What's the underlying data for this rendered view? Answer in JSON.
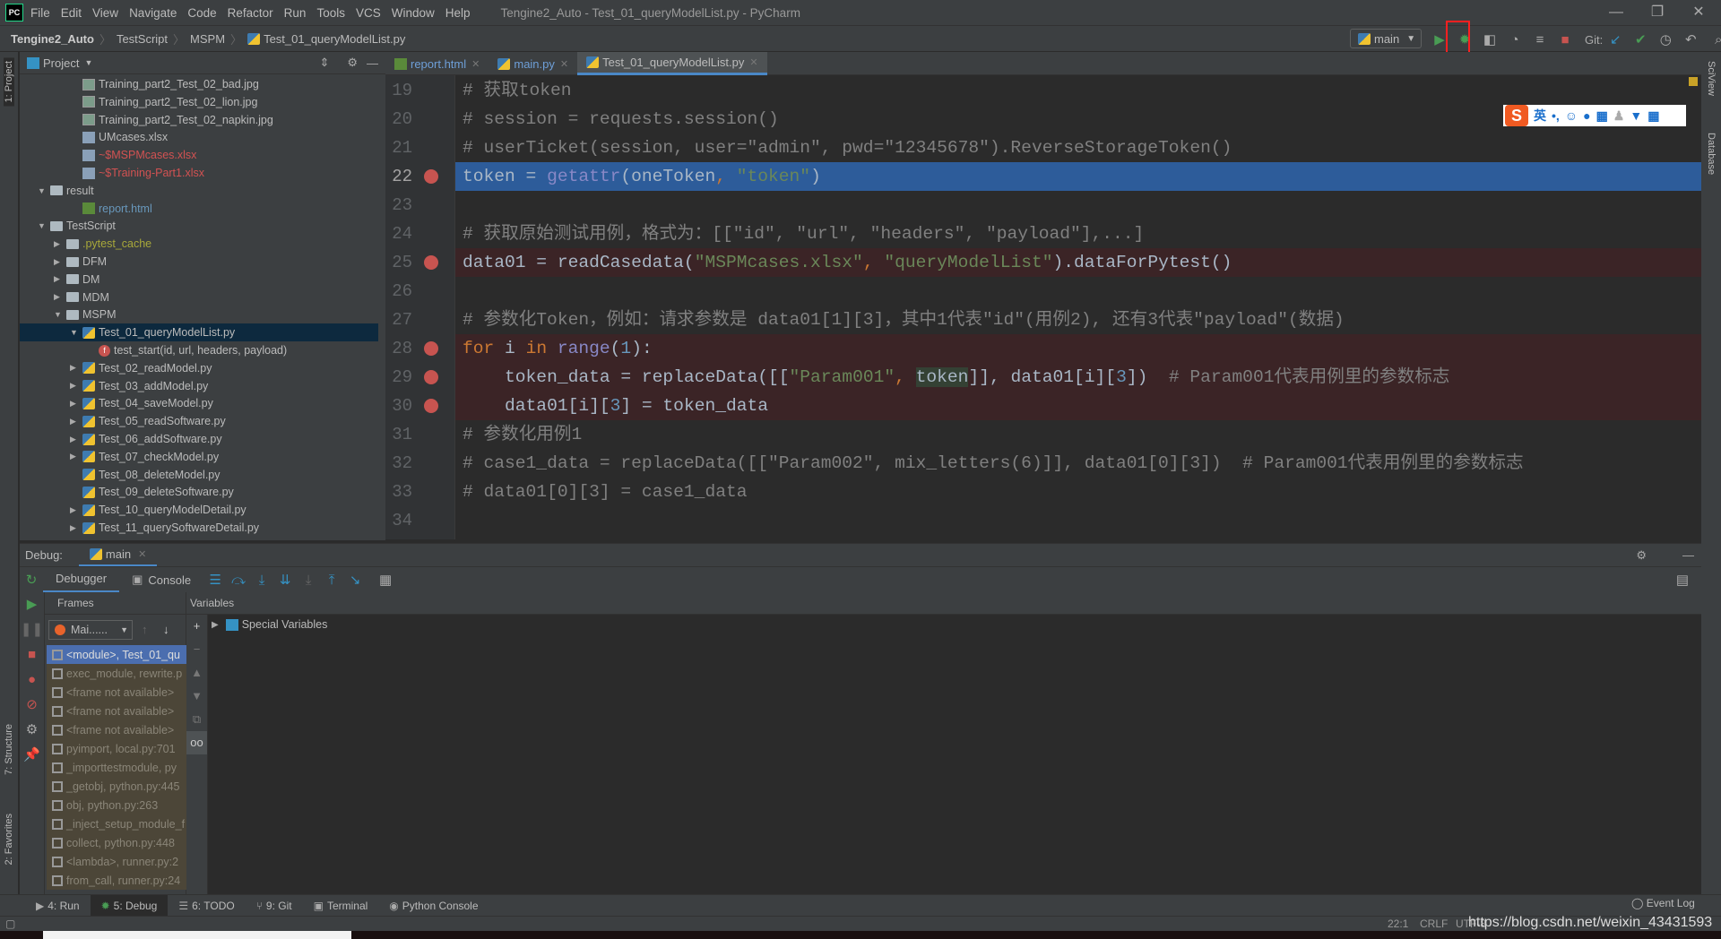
{
  "menubar": {
    "logo": "PC",
    "items": [
      "File",
      "Edit",
      "View",
      "Navigate",
      "Code",
      "Refactor",
      "Run",
      "Tools",
      "VCS",
      "Window",
      "Help"
    ],
    "title": "Tengine2_Auto - Test_01_queryModelList.py - PyCharm"
  },
  "navbar": {
    "crumbs": [
      "Tengine2_Auto",
      "TestScript",
      "MSPM",
      "Test_01_queryModelList.py"
    ],
    "run_config": "main",
    "git_label": "Git:"
  },
  "project": {
    "title": "Project",
    "sidebar_tab": "1: Project",
    "tree": [
      {
        "label": "Training_part2_Test_02_bad.jpg",
        "level": 3,
        "icon": "image-file",
        "arrow": ""
      },
      {
        "label": "Training_part2_Test_02_lion.jpg",
        "level": 3,
        "icon": "image-file",
        "arrow": ""
      },
      {
        "label": "Training_part2_Test_02_napkin.jpg",
        "level": 3,
        "icon": "image-file",
        "arrow": ""
      },
      {
        "label": "UMcases.xlsx",
        "level": 3,
        "icon": "xlsx-file",
        "arrow": ""
      },
      {
        "label": "~$MSPMcases.xlsx",
        "level": 3,
        "icon": "xlsx-file",
        "arrow": "",
        "color": "#d25252"
      },
      {
        "label": "~$Training-Part1.xlsx",
        "level": 3,
        "icon": "xlsx-file",
        "arrow": "",
        "color": "#d25252"
      },
      {
        "label": "result",
        "level": 1,
        "icon": "folder",
        "arrow": "down"
      },
      {
        "label": "report.html",
        "level": 3,
        "icon": "html-file",
        "arrow": "",
        "color": "#6897bb"
      },
      {
        "label": "TestScript",
        "level": 1,
        "icon": "folder",
        "arrow": "down"
      },
      {
        "label": ".pytest_cache",
        "level": 2,
        "icon": "folder",
        "arrow": "right",
        "color": "#a8a83a"
      },
      {
        "label": "DFM",
        "level": 2,
        "icon": "folder",
        "arrow": "right"
      },
      {
        "label": "DM",
        "level": 2,
        "icon": "folder",
        "arrow": "right"
      },
      {
        "label": "MDM",
        "level": 2,
        "icon": "folder",
        "arrow": "right"
      },
      {
        "label": "MSPM",
        "level": 2,
        "icon": "folder",
        "arrow": "down"
      },
      {
        "label": "Test_01_queryModelList.py",
        "level": 3,
        "icon": "python-file",
        "arrow": "down",
        "selected": true
      },
      {
        "label": "test_start(id, url, headers, payload)",
        "level": 4,
        "icon": "function",
        "arrow": ""
      },
      {
        "label": "Test_02_readModel.py",
        "level": 3,
        "icon": "python-file",
        "arrow": "right"
      },
      {
        "label": "Test_03_addModel.py",
        "level": 3,
        "icon": "python-file",
        "arrow": "right"
      },
      {
        "label": "Test_04_saveModel.py",
        "level": 3,
        "icon": "python-file",
        "arrow": "right"
      },
      {
        "label": "Test_05_readSoftware.py",
        "level": 3,
        "icon": "python-file",
        "arrow": "right"
      },
      {
        "label": "Test_06_addSoftware.py",
        "level": 3,
        "icon": "python-file",
        "arrow": "right"
      },
      {
        "label": "Test_07_checkModel.py",
        "level": 3,
        "icon": "python-file",
        "arrow": "right"
      },
      {
        "label": "Test_08_deleteModel.py",
        "level": 3,
        "icon": "python-file",
        "arrow": ""
      },
      {
        "label": "Test_09_deleteSoftware.py",
        "level": 3,
        "icon": "python-file",
        "arrow": ""
      },
      {
        "label": "Test_10_queryModelDetail.py",
        "level": 3,
        "icon": "python-file",
        "arrow": "right"
      },
      {
        "label": "Test_11_querySoftwareDetail.py",
        "level": 3,
        "icon": "python-file",
        "arrow": "right"
      }
    ]
  },
  "editor": {
    "tabs": [
      {
        "label": "report.html",
        "icon": "html-file"
      },
      {
        "label": "main.py",
        "icon": "python-file"
      },
      {
        "label": "Test_01_queryModelList.py",
        "icon": "python-file",
        "active": true
      }
    ],
    "lines": [
      {
        "n": 19,
        "segs": [
          [
            "# 获取token",
            "c"
          ]
        ]
      },
      {
        "n": 20,
        "segs": [
          [
            "# session = requests.session()",
            "c"
          ]
        ]
      },
      {
        "n": 21,
        "segs": [
          [
            "# userTicket(session, user=\"admin\", pwd=\"12345678\").ReverseStorageToken()",
            "c"
          ]
        ]
      },
      {
        "n": 22,
        "current": true,
        "breakpoint": true,
        "segs": [
          [
            "token = ",
            ""
          ],
          [
            "getattr",
            "b"
          ],
          [
            "(oneToken",
            ""
          ],
          [
            ", ",
            "k"
          ],
          [
            "\"token\"",
            "s"
          ],
          [
            ")",
            ""
          ]
        ]
      },
      {
        "n": 23,
        "segs": []
      },
      {
        "n": 24,
        "segs": [
          [
            "# 获取原始测试用例，格式为：[[\"id\", \"url\", \"headers\", \"payload\"],...]",
            "c"
          ]
        ]
      },
      {
        "n": 25,
        "breakpoint": true,
        "segs": [
          [
            "data01 = readCasedata(",
            ""
          ],
          [
            "\"MSPMcases.xlsx\"",
            "s"
          ],
          [
            ", ",
            "k"
          ],
          [
            "\"queryModelList\"",
            "s"
          ],
          [
            ").dataForPytest()",
            ""
          ]
        ]
      },
      {
        "n": 26,
        "segs": []
      },
      {
        "n": 27,
        "segs": [
          [
            "# 参数化Token，例如：请求参数是 data01[1][3]，其中1代表\"id\"(用例2), 还有3代表\"payload\"(数据)",
            "c"
          ]
        ]
      },
      {
        "n": 28,
        "breakpoint": true,
        "segs": [
          [
            "for ",
            "k"
          ],
          [
            "i ",
            ""
          ],
          [
            "in ",
            "k"
          ],
          [
            "range",
            "b"
          ],
          [
            "(",
            ""
          ],
          [
            "1",
            "n"
          ],
          [
            "):",
            ""
          ]
        ]
      },
      {
        "n": 29,
        "breakpoint": true,
        "segs": [
          [
            "    token_data = replaceData([[",
            ""
          ],
          [
            "\"Param001\"",
            "s"
          ],
          [
            ", ",
            "k"
          ],
          [
            "token",
            "h"
          ],
          [
            "]], data01[i][",
            ""
          ],
          [
            "3",
            "n"
          ],
          [
            "])  ",
            ""
          ],
          [
            "# Param001代表用例里的参数标志",
            "c"
          ]
        ]
      },
      {
        "n": 30,
        "breakpoint": true,
        "segs": [
          [
            "    data01[i][",
            ""
          ],
          [
            "3",
            "n"
          ],
          [
            "] = token_data",
            ""
          ]
        ]
      },
      {
        "n": 31,
        "segs": [
          [
            "# 参数化用例1",
            "c"
          ]
        ]
      },
      {
        "n": 32,
        "segs": [
          [
            "# case1_data = replaceData([[\"Param002\", mix_letters(6)]], data01[0][3])  # Param001代表用例里的参数标志",
            "c"
          ]
        ]
      },
      {
        "n": 33,
        "segs": [
          [
            "# data01[0][3] = case1_data",
            "c"
          ]
        ]
      },
      {
        "n": 34,
        "segs": []
      }
    ]
  },
  "ime": {
    "lang": "英",
    "punct": "•,"
  },
  "right_strip": [
    "SciView",
    "Database"
  ],
  "left_strip_bottom": [
    "7: Structure",
    "2: Favorites"
  ],
  "debug": {
    "label": "Debug:",
    "session": "main",
    "tabs": [
      "Debugger",
      "Console"
    ],
    "frames_title": "Frames",
    "variables_title": "Variables",
    "thread": "Mai......",
    "special_vars": "Special Variables",
    "frames": [
      "<module>, Test_01_qu",
      "exec_module, rewrite.p",
      "<frame not available>",
      "<frame not available>",
      "<frame not available>",
      "pyimport, local.py:701",
      "_importtestmodule, py",
      "_getobj, python.py:445",
      "obj, python.py:263",
      "_inject_setup_module_f",
      "collect, python.py:448",
      "<lambda>, runner.py:2",
      "from_call, runner.py:24"
    ]
  },
  "bottombar": [
    {
      "label": "4: Run",
      "icon": "run-icon"
    },
    {
      "label": "5: Debug",
      "icon": "bug-icon",
      "active": true
    },
    {
      "label": "6: TODO",
      "icon": "todo-icon"
    },
    {
      "label": "9: Git",
      "icon": "git-icon"
    },
    {
      "label": "Terminal",
      "icon": "terminal-icon"
    },
    {
      "label": "Python Console",
      "icon": "python-console-icon"
    }
  ],
  "event_log": "Event Log",
  "status": {
    "position": "22:1",
    "line_sep": "CRLF",
    "encoding": "UTF-8",
    "watermark": "https://blog.csdn.net/weixin_43431593"
  },
  "colors": {
    "accent": "#4a88c7",
    "breakpoint": "#c75450",
    "current_line": "#2d5c9a",
    "annotation": "#ff2020"
  }
}
